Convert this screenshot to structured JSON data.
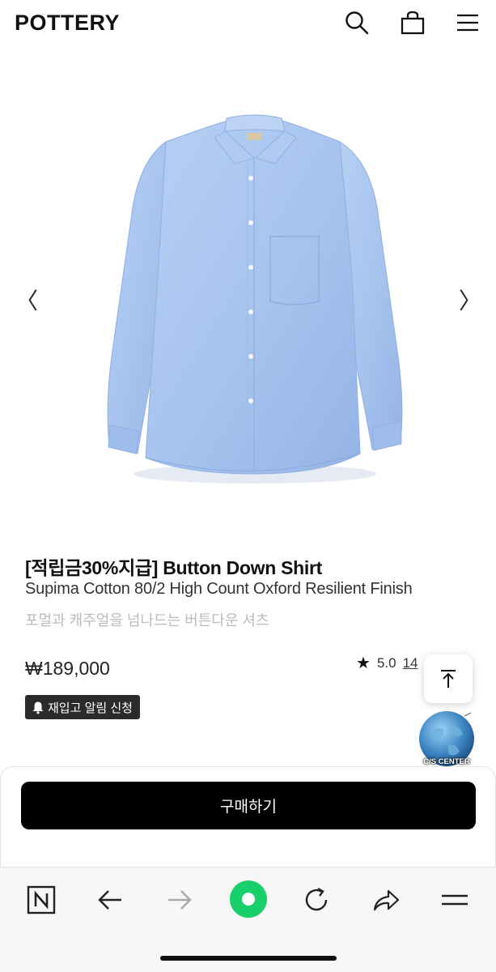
{
  "header": {
    "logo": "POTTERY",
    "icons": [
      "search-icon",
      "shopping-bag-icon",
      "menu-icon"
    ]
  },
  "gallery": {
    "prev_arrow": "〈",
    "next_arrow": "〉",
    "shirt_color": "#a9c6ef"
  },
  "product": {
    "title": "[적립금30%지급] Button Down Shirt",
    "subtitle": "Supima Cotton 80/2 High Count Oxford Resilient Finish",
    "description": "포멀과 캐주얼을 넘나드는 버튼다운 셔츠",
    "price": "₩189,000",
    "rating": "5.0",
    "review_count": "14"
  },
  "restock": {
    "label": "재입고 알림 신청"
  },
  "floating": {
    "cs_label": "C/S CENTER"
  },
  "purchase": {
    "buy_label": "구매하기"
  },
  "toolbar": {
    "icons": [
      "naver-icon",
      "back-icon",
      "forward-icon",
      "green-home-icon",
      "refresh-icon",
      "share-icon",
      "menu-icon"
    ],
    "accent": "#18d06b"
  }
}
